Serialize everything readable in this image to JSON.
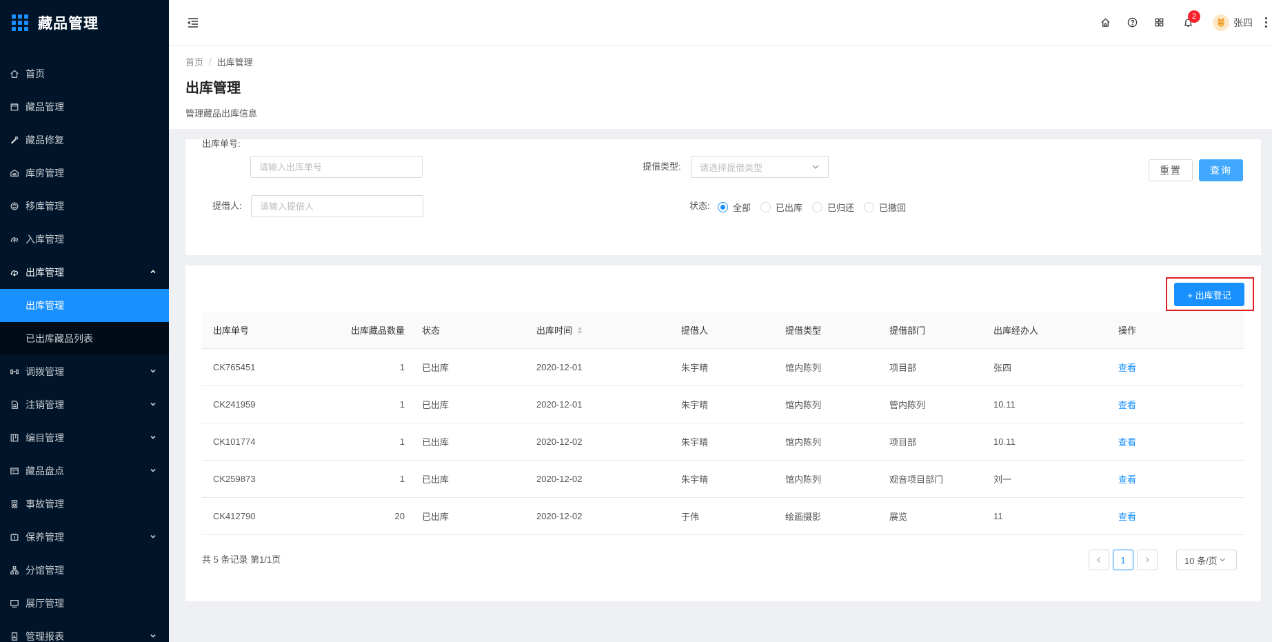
{
  "app": {
    "title": "藏品管理"
  },
  "sidebar": {
    "items": [
      {
        "label": "首页",
        "icon": "home-icon",
        "arrow": false
      },
      {
        "label": "藏品管理",
        "icon": "calendar-icon",
        "arrow": false
      },
      {
        "label": "藏品修复",
        "icon": "wrench-icon",
        "arrow": false
      },
      {
        "label": "库房管理",
        "icon": "warehouse-icon",
        "arrow": false
      },
      {
        "label": "移库管理",
        "icon": "transfer-icon",
        "arrow": false
      },
      {
        "label": "入库管理",
        "icon": "cloud-upload-icon",
        "arrow": false
      },
      {
        "label": "出库管理",
        "icon": "cloud-download-icon",
        "arrow": true,
        "open": true,
        "children": [
          {
            "label": "出库管理",
            "active": true
          },
          {
            "label": "已出库藏品列表",
            "active": false
          }
        ]
      },
      {
        "label": "调拨管理",
        "icon": "swap-icon",
        "arrow": true
      },
      {
        "label": "注销管理",
        "icon": "file-icon",
        "arrow": true
      },
      {
        "label": "编目管理",
        "icon": "catalog-icon",
        "arrow": true
      },
      {
        "label": "藏品盘点",
        "icon": "inventory-icon",
        "arrow": true
      },
      {
        "label": "事故管理",
        "icon": "report-icon",
        "arrow": false
      },
      {
        "label": "保养管理",
        "icon": "maintain-icon",
        "arrow": true
      },
      {
        "label": "分馆管理",
        "icon": "branch-icon",
        "arrow": false
      },
      {
        "label": "展厅管理",
        "icon": "hall-icon",
        "arrow": false
      },
      {
        "label": "管理报表",
        "icon": "chart-report-icon",
        "arrow": true
      }
    ]
  },
  "header": {
    "notifications_count": "2",
    "user_name": "张四"
  },
  "page": {
    "breadcrumb": [
      "首页",
      "出库管理"
    ],
    "breadcrumb_sep": "/",
    "title": "出库管理",
    "description": "管理藏品出库信息"
  },
  "filters": {
    "order_no_label": "出库单号:",
    "order_no_placeholder": "请输入出库单号",
    "borrow_type_label": "提借类型:",
    "borrow_type_placeholder": "请选择提借类型",
    "borrower_label": "提借人:",
    "borrower_placeholder": "请输入提借人",
    "status_label": "状态:",
    "status_options": [
      {
        "label": "全部",
        "checked": true
      },
      {
        "label": "已出库",
        "checked": false
      },
      {
        "label": "已归还",
        "checked": false
      },
      {
        "label": "已撤回",
        "checked": false
      }
    ],
    "reset_label": "重置",
    "query_label": "查询"
  },
  "table": {
    "register_label": "+ 出库登记",
    "columns": [
      "出库单号",
      "出库藏品数量",
      "状态",
      "出库时间",
      "提借人",
      "提借类型",
      "提借部门",
      "出库经办人",
      "操作"
    ],
    "rows": [
      [
        "CK765451",
        "1",
        "已出库",
        "2020-12-01",
        "朱宇晴",
        "馆内陈列",
        "项目部",
        "张四",
        "查看"
      ],
      [
        "CK241959",
        "1",
        "已出库",
        "2020-12-01",
        "朱宇晴",
        "馆内陈列",
        "管内陈列",
        "10.11",
        "查看"
      ],
      [
        "CK101774",
        "1",
        "已出库",
        "2020-12-02",
        "朱宇晴",
        "馆内陈列",
        "项目部",
        "10.11",
        "查看"
      ],
      [
        "CK259873",
        "1",
        "已出库",
        "2020-12-02",
        "朱宇晴",
        "馆内陈列",
        "观音项目部门",
        "刘一",
        "查看"
      ],
      [
        "CK412790",
        "20",
        "已出库",
        "2020-12-02",
        "于伟",
        "绘画摄影",
        "展览",
        "11",
        "查看"
      ]
    ],
    "summary": "共 5 条记录 第1/1页",
    "current_page": "1",
    "page_size": "10 条/页"
  },
  "colors": {
    "primary": "#1890ff",
    "sidebar_bg": "#001529",
    "highlight": "#e02020"
  }
}
